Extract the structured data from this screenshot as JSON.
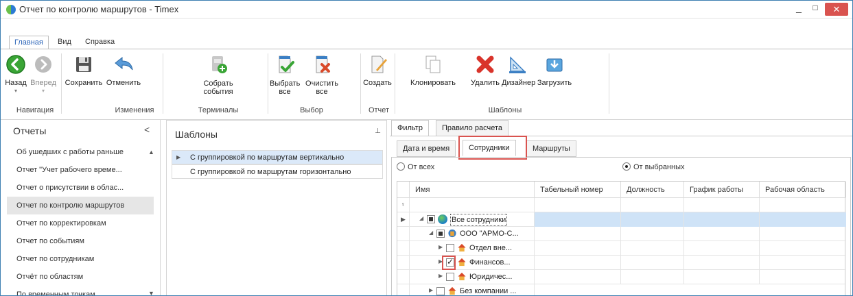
{
  "window": {
    "title": "Отчет по контролю маршрутов - Timex",
    "minimize_glyph": "_",
    "maximize_glyph": "□",
    "close_glyph": "✕"
  },
  "menu_tabs": [
    "Главная",
    "Вид",
    "Справка"
  ],
  "ribbon": {
    "buttons": [
      {
        "label": "Назад",
        "icon": "back-arrow-icon"
      },
      {
        "label": "Вперед",
        "icon": "forward-arrow-icon"
      },
      {
        "label": "Сохранить",
        "icon": "save-icon"
      },
      {
        "label": "Отменить",
        "icon": "undo-icon"
      },
      {
        "label": "Собрать события",
        "icon": "collect-events-icon"
      },
      {
        "label": "Выбрать все",
        "icon": "select-all-icon"
      },
      {
        "label": "Очистить все",
        "icon": "clear-all-icon"
      },
      {
        "label": "Создать",
        "icon": "create-icon"
      },
      {
        "label": "Клонировать",
        "icon": "clone-icon"
      },
      {
        "label": "Удалить",
        "icon": "delete-icon"
      },
      {
        "label": "Дизайнер",
        "icon": "designer-icon"
      },
      {
        "label": "Загрузить",
        "icon": "load-icon"
      }
    ],
    "groups": [
      "Навигация",
      "Изменения",
      "Терминалы",
      "Выбор",
      "Отчет",
      "Шаблоны"
    ]
  },
  "left_panel": {
    "title": "Отчеты",
    "collapse_glyph": "<",
    "items": [
      "Об ушедших с работы раньше",
      "Отчет \"Учет рабочего време...",
      "Отчет о присутствии в облас...",
      "Отчет по контролю маршрутов",
      "Отчет по корректировкам",
      "Отчет по событиям",
      "Отчет по сотрудникам",
      "Отчёт по областям",
      "По временным точкам"
    ],
    "selected_index": 3
  },
  "templates_panel": {
    "title": "Шаблоны",
    "pin_glyph": "⊥",
    "rows": [
      "С группировкой по маршрутам вертикально",
      "С группировкой по маршрутам горизонтально"
    ],
    "selected_index": 0
  },
  "filter": {
    "outer_tabs": [
      "Фильтр",
      "Правило расчета"
    ],
    "inner_tabs": [
      "Дата и время",
      "Сотрудники",
      "Маршруты"
    ],
    "active_inner_tab": "Сотрудники",
    "radio_all": "От всех",
    "radio_selected": "От выбранных",
    "radio_value": "selected"
  },
  "grid": {
    "columns": [
      "Имя",
      "Табельный номер",
      "Должность",
      "График работы",
      "Рабочая область"
    ],
    "filter_row_glyph": "♀",
    "tree": [
      {
        "label": "Все сотрудники",
        "check": "partial",
        "icon": "globe-icon",
        "selected": true
      },
      {
        "label": "ООО \"АРМО-С...",
        "check": "partial",
        "icon": "company-icon"
      },
      {
        "label": "Отдел вне...",
        "check": "none",
        "icon": "department-icon"
      },
      {
        "label": "Финансов...",
        "check": "checked",
        "icon": "department-icon"
      },
      {
        "label": "Юридичес...",
        "check": "none",
        "icon": "department-icon"
      },
      {
        "label": "Без компании ...",
        "check": "none",
        "icon": "department-icon"
      }
    ]
  },
  "colors": {
    "accent": "#2b64b8",
    "selection": "#cfe3f7",
    "highlight": "#d9534f",
    "close": "#d9534f"
  }
}
